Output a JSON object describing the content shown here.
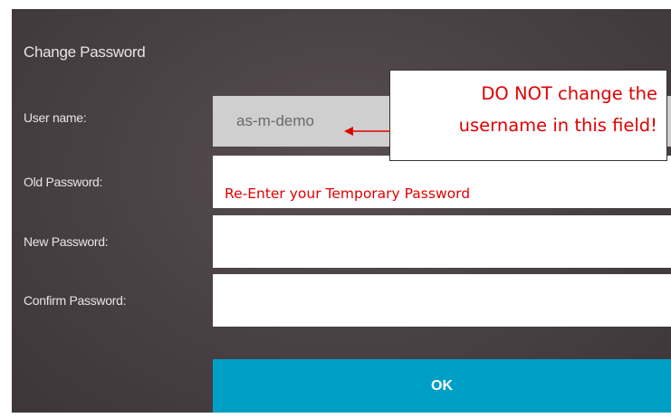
{
  "dialog": {
    "title": "Change Password"
  },
  "fields": {
    "username": {
      "label": "User name:",
      "value": "as-m-demo"
    },
    "old_password": {
      "label": "Old Password:",
      "value": ""
    },
    "new_password": {
      "label": "New Password:",
      "value": ""
    },
    "confirm_password": {
      "label": "Confirm Password:",
      "value": ""
    }
  },
  "annotations": {
    "callout_line1": "DO NOT change the",
    "callout_line2": "username in this field!",
    "old_password_hint": "Re-Enter your Temporary Password",
    "color": "#e00000"
  },
  "ok_button": {
    "label": "OK",
    "color": "#00a0c6"
  }
}
